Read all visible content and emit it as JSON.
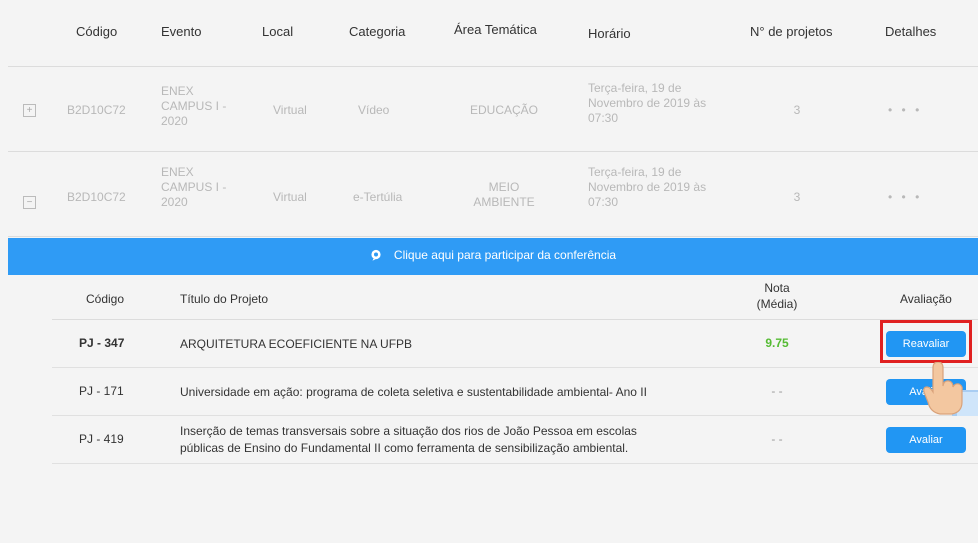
{
  "header": {
    "codigo": "Código",
    "evento": "Evento",
    "local": "Local",
    "categoria": "Categoria",
    "area": "Área Temática",
    "horario": "Horário",
    "projetos": "N° de projetos",
    "detalhes": "Detalhes"
  },
  "events": [
    {
      "toggle": "+",
      "codigo": "B2D10C72",
      "evento": [
        "ENEX",
        "CAMPUS I -",
        "2020"
      ],
      "local": "Virtual",
      "categoria": "Vídeo",
      "area": [
        "EDUCAÇÃO"
      ],
      "horario": [
        "Terça-feira, 19 de",
        "Novembro de 2019 às",
        "07:30"
      ],
      "projetos": "3",
      "detalhes": "• • •"
    },
    {
      "toggle": "−",
      "codigo": "B2D10C72",
      "evento": [
        "ENEX",
        "CAMPUS I -",
        "2020"
      ],
      "local": "Virtual",
      "categoria": "e-Tertúlia",
      "area": [
        "MEIO",
        "AMBIENTE"
      ],
      "horario": [
        "Terça-feira, 19 de",
        "Novembro de 2019 às",
        "07:30"
      ],
      "projetos": "3",
      "detalhes": "• • •"
    }
  ],
  "banner": {
    "text": "Clique aqui para participar da conferência",
    "color": "#2f9bf5"
  },
  "projects_header": {
    "codigo": "Código",
    "titulo": "Título do Projeto",
    "nota_line1": "Nota",
    "nota_line2": "(Média)",
    "avaliacao": "Avaliação"
  },
  "projects": [
    {
      "codigo": "PJ - 347",
      "titulo": [
        "ARQUITETURA ECOEFICIENTE NA UFPB"
      ],
      "nota": "9.75",
      "button": "Reavaliar"
    },
    {
      "codigo": "PJ - 171",
      "titulo": [
        "Universidade em ação: programa de coleta seletiva e sustentabilidade ambiental- Ano II"
      ],
      "nota": "- -",
      "button": "Avaliar"
    },
    {
      "codigo": "PJ - 419",
      "titulo": [
        "Inserção de temas transversais sobre a situação dos rios de João Pessoa em escolas",
        "públicas de Ensino do Fundamental II como ferramenta de sensibilização ambiental."
      ],
      "nota": "- -",
      "button": "Avaliar"
    }
  ],
  "colors": {
    "accent": "#2196f3",
    "highlight": "#e02020",
    "nota_green": "#55bb33"
  }
}
